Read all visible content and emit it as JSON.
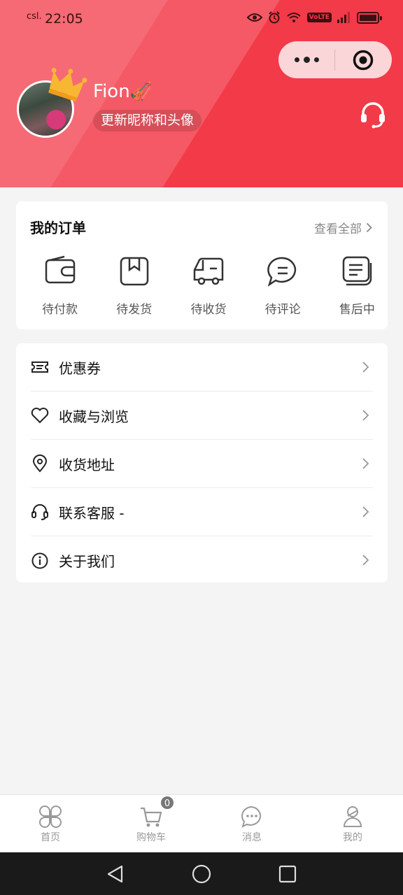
{
  "statusbar": {
    "carrier": "csl.",
    "time": "22:05",
    "volte_label": "VoLTE",
    "icons": [
      "eye-icon",
      "alarm-icon",
      "wifi-icon",
      "volte-icon",
      "signal-icon",
      "battery-icon"
    ]
  },
  "capsule": {
    "more_icon": "more-dots-icon",
    "close_icon": "target-circle-icon"
  },
  "profile": {
    "nickname": "Fion🎻",
    "edit_label": "更新昵称和头像",
    "crown_icon": "crown-icon",
    "service_icon": "headset-icon"
  },
  "orders": {
    "title": "我的订单",
    "view_all": "查看全部",
    "items": [
      {
        "label": "待付款",
        "icon": "wallet-icon"
      },
      {
        "label": "待发货",
        "icon": "box-icon"
      },
      {
        "label": "待收货",
        "icon": "truck-icon"
      },
      {
        "label": "待评论",
        "icon": "comment-icon"
      },
      {
        "label": "售后中",
        "icon": "after-sales-icon"
      }
    ]
  },
  "menu": {
    "items": [
      {
        "label": "优惠券",
        "icon": "ticket-icon"
      },
      {
        "label": "收藏与浏览",
        "icon": "heart-icon"
      },
      {
        "label": "收货地址",
        "icon": "location-icon"
      },
      {
        "label": "联系客服 -",
        "icon": "headset-icon"
      },
      {
        "label": "关于我们",
        "icon": "info-icon"
      }
    ]
  },
  "tabbar": {
    "tabs": [
      {
        "label": "首页",
        "icon": "home-clover-icon"
      },
      {
        "label": "购物车",
        "icon": "cart-icon",
        "badge": "0"
      },
      {
        "label": "消息",
        "icon": "message-icon"
      },
      {
        "label": "我的",
        "icon": "user-icon"
      }
    ]
  },
  "colors": {
    "brand_red": "#f23a48",
    "text_dark": "#222222",
    "text_muted": "#888888",
    "tab_inactive": "#999999"
  }
}
